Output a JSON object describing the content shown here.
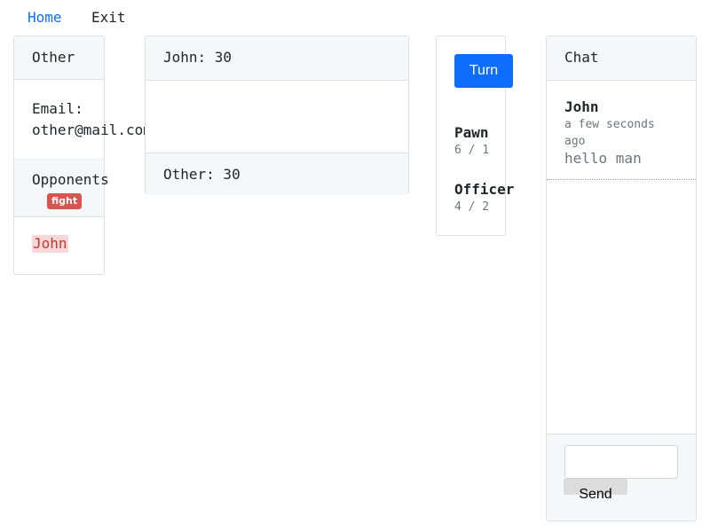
{
  "nav": {
    "home_label": "Home",
    "exit_label": "Exit"
  },
  "player": {
    "title": "Other",
    "email_label": "Email:",
    "email_value": "other@mail.com",
    "opponents_label": "Opponents",
    "fight_badge": "fight",
    "opponents": [
      "John"
    ]
  },
  "scores": {
    "top": "John: 30",
    "bottom": "Other: 30"
  },
  "actions": {
    "turn_label": "Turn",
    "pieces": [
      {
        "name": "Pawn",
        "count": "6 / 1"
      },
      {
        "name": "Officer",
        "count": "4 / 2"
      }
    ]
  },
  "chat": {
    "title": "Chat",
    "messages": [
      {
        "author": "John",
        "time": "a few seconds ago",
        "text": "hello man"
      }
    ],
    "input_value": "",
    "send_label": "Send"
  },
  "colors": {
    "primary": "#0d6efd",
    "danger": "#d9534f",
    "highlight": "#f8d7da"
  }
}
